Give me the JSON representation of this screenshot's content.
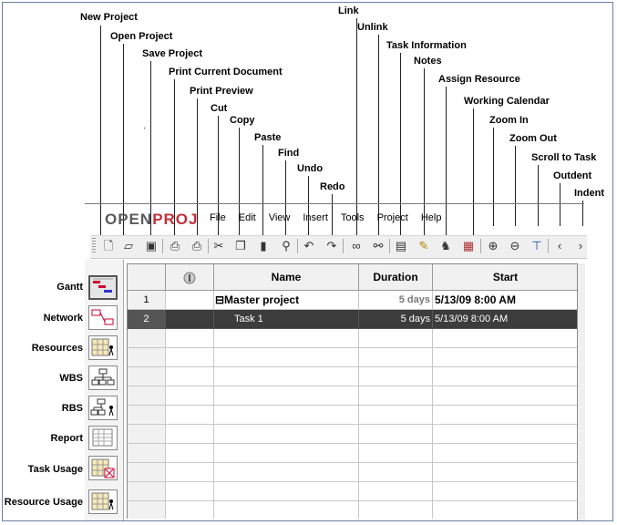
{
  "callouts": {
    "new_project": "New Project",
    "open_project": "Open Project",
    "save_project": "Save Project",
    "print_current": "Print Current Document",
    "print_preview": "Print Preview",
    "cut": "Cut",
    "copy": "Copy",
    "paste": "Paste",
    "find": "Find",
    "undo": "Undo",
    "redo": "Redo",
    "link": "Link",
    "unlink": "Unlink",
    "task_information": "Task Information",
    "notes": "Notes",
    "assign_resource": "Assign Resource",
    "working_calendar": "Working Calendar",
    "zoom_in": "Zoom In",
    "zoom_out": "Zoom Out",
    "scroll_to_task": "Scroll to Task",
    "outdent": "Outdent",
    "indent": "Indent"
  },
  "app": {
    "logo_open": "OPEN",
    "logo_proj": "PROJ",
    "menu": [
      "File",
      "Edit",
      "View",
      "Insert",
      "Tools",
      "Project",
      "Help"
    ]
  },
  "views": {
    "gantt": "Gantt",
    "network": "Network",
    "resources": "Resources",
    "wbs": "WBS",
    "rbs": "RBS",
    "report": "Report",
    "task_usage": "Task Usage",
    "resource_usage": "Resource Usage"
  },
  "grid": {
    "headers": {
      "name": "Name",
      "duration": "Duration",
      "start": "Start"
    },
    "rows": [
      {
        "num": "1",
        "name": "⊟Master project",
        "duration": "5 days",
        "start": "5/13/09 8:00 AM"
      },
      {
        "num": "2",
        "name": "Task 1",
        "duration": "5 days",
        "start": "5/13/09 8:00 AM"
      }
    ]
  },
  "colors": {
    "logo_red": "#c0303a",
    "selected_row": "#3c3c3c"
  }
}
